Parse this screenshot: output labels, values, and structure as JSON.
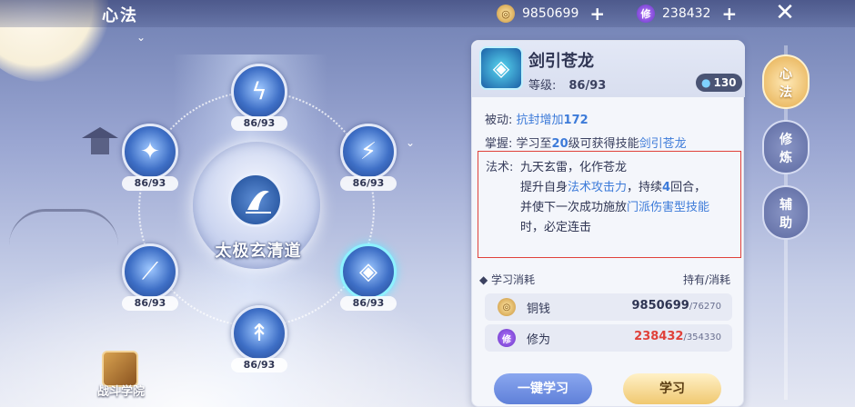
{
  "header": {
    "title": "心法",
    "copper": {
      "icon": "copper-coin-icon",
      "value": "9850699"
    },
    "cultivation": {
      "icon_text": "修",
      "value": "238432"
    }
  },
  "wheel": {
    "school_name": "太极玄清道",
    "nodes": [
      {
        "level": "86/93"
      },
      {
        "level": "86/93"
      },
      {
        "level": "86/93"
      },
      {
        "level": "86/93"
      },
      {
        "level": "86/93"
      },
      {
        "level": "86/93"
      }
    ],
    "school_button": "战斗学院"
  },
  "skill": {
    "name": "剑引苍龙",
    "grade_label": "等级:",
    "grade_value": "86/93",
    "cost": "130",
    "passive_label": "被动:",
    "passive_text": "抗封增加",
    "passive_value": "172",
    "master_label": "掌握:",
    "master_text_1": "学习至",
    "master_level": "20",
    "master_text_2": "级可获得技能",
    "master_skill": "剑引苍龙",
    "spell_label": "法术:",
    "spell_line1": "九天玄雷，化作苍龙",
    "spell_line2_a": "提升自身",
    "spell_line2_b": "法术攻击力",
    "spell_line2_c": "，持续",
    "spell_line2_d": "4",
    "spell_line2_e": "回合，",
    "spell_line3_a": "并使下一次成功施放",
    "spell_line3_b": "门派伤害型技能",
    "spell_line4": "时，必定连击"
  },
  "learning": {
    "title": "学习消耗",
    "right_title": "持有/消耗",
    "copper_label": "铜钱",
    "copper_have": "9850699",
    "copper_need": "/76270",
    "cult_icon_text": "修",
    "cult_label": "修为",
    "cult_have": "238432",
    "cult_need": "/354330",
    "btn_quick": "一键学习",
    "btn_learn": "学习"
  },
  "tabs": [
    {
      "label": "心法",
      "active": true
    },
    {
      "label": "修炼",
      "active": false
    },
    {
      "label": "辅助",
      "active": false
    }
  ],
  "colors": {
    "highlight_blue": "#3d7bd9",
    "insufficient_red": "#e0413a",
    "active_tab_gold": "#e5ad4e"
  }
}
